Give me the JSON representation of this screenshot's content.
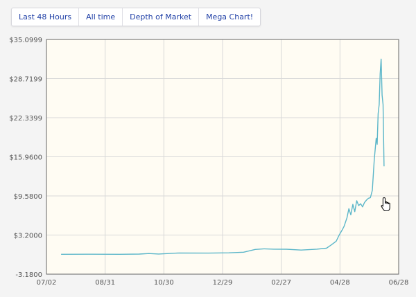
{
  "tabs": [
    {
      "label": "Last 48 Hours"
    },
    {
      "label": "All time"
    },
    {
      "label": "Depth of Market"
    },
    {
      "label": "Mega Chart!"
    }
  ],
  "colors": {
    "line": "#5bb6c9",
    "plot_background": "#fffcf3",
    "grid": "#d8d8d8",
    "border": "#666666"
  },
  "icons": {
    "cursor": "hand-pointer-icon"
  },
  "chart_data": {
    "type": "line",
    "title": "",
    "xlabel": "",
    "ylabel": "",
    "grid": true,
    "x_ticks": [
      "07/02",
      "08/31",
      "10/30",
      "12/29",
      "02/27",
      "04/28",
      "06/28"
    ],
    "y_ticks": [
      "-3.1800",
      "$3.2000",
      "$9.5800",
      "$15.9600",
      "$22.3399",
      "$28.7199",
      "$35.0999"
    ],
    "ylim": [
      -3.18,
      35.0999
    ],
    "xlim": [
      "2010-07-02",
      "2011-06-28"
    ],
    "series": [
      {
        "x": [
          "2010-07-17",
          "2010-08-15",
          "2010-09-15",
          "2010-10-05",
          "2010-10-15",
          "2010-10-25",
          "2010-11-15",
          "2010-12-15",
          "2011-01-05",
          "2011-01-20",
          "2011-02-01",
          "2011-02-10",
          "2011-02-20",
          "2011-03-05",
          "2011-03-20",
          "2011-04-05",
          "2011-04-15",
          "2011-04-20",
          "2011-04-25",
          "2011-04-28",
          "2011-05-01",
          "2011-05-03",
          "2011-05-06",
          "2011-05-08",
          "2011-05-10",
          "2011-05-12",
          "2011-05-14",
          "2011-05-16",
          "2011-05-18",
          "2011-05-20",
          "2011-05-22",
          "2011-05-24",
          "2011-05-26",
          "2011-05-28",
          "2011-05-30",
          "2011-06-01",
          "2011-06-03",
          "2011-06-05",
          "2011-06-06",
          "2011-06-07",
          "2011-06-08",
          "2011-06-09",
          "2011-06-10",
          "2011-06-11",
          "2011-06-12",
          "2011-06-13"
        ],
        "y": [
          0.06,
          0.07,
          0.06,
          0.1,
          0.19,
          0.11,
          0.28,
          0.25,
          0.3,
          0.4,
          0.85,
          0.95,
          0.9,
          0.88,
          0.75,
          0.9,
          1.05,
          1.6,
          2.2,
          3.2,
          4.0,
          4.6,
          6.0,
          7.5,
          6.5,
          8.2,
          7.0,
          8.8,
          8.0,
          8.3,
          7.8,
          8.5,
          8.9,
          9.2,
          9.3,
          10.5,
          15.5,
          19.0,
          18.0,
          23.0,
          24.5,
          29.5,
          31.9,
          26.0,
          24.5,
          14.4
        ]
      }
    ]
  }
}
